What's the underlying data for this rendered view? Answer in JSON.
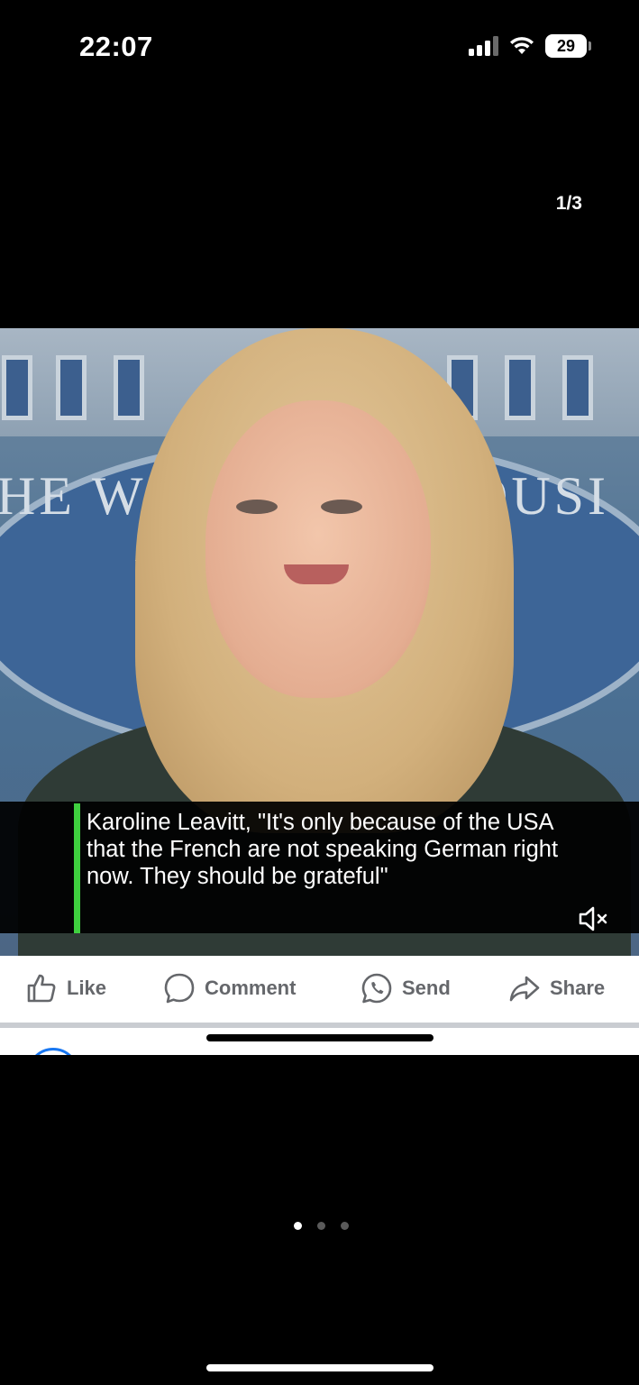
{
  "status_bar": {
    "time": "22:07",
    "battery": "29"
  },
  "viewer": {
    "page_counter": "1/3",
    "pages_total": 3,
    "page_active": 1
  },
  "post": {
    "video": {
      "backdrop_text_left": "HE W",
      "backdrop_text_right": "OUSI",
      "backdrop_text_small": "W",
      "caption": "Karoline Leavitt, \"It's only because of the USA that the French are not speaking German right now. They should be grateful\"",
      "muted": true
    },
    "actions": {
      "like": "Like",
      "comment": "Comment",
      "send": "Send",
      "share": "Share"
    }
  },
  "colors": {
    "caption_accent": "#3fcf3f",
    "action_gray": "#65676b",
    "brand_blue": "#1877f2"
  }
}
